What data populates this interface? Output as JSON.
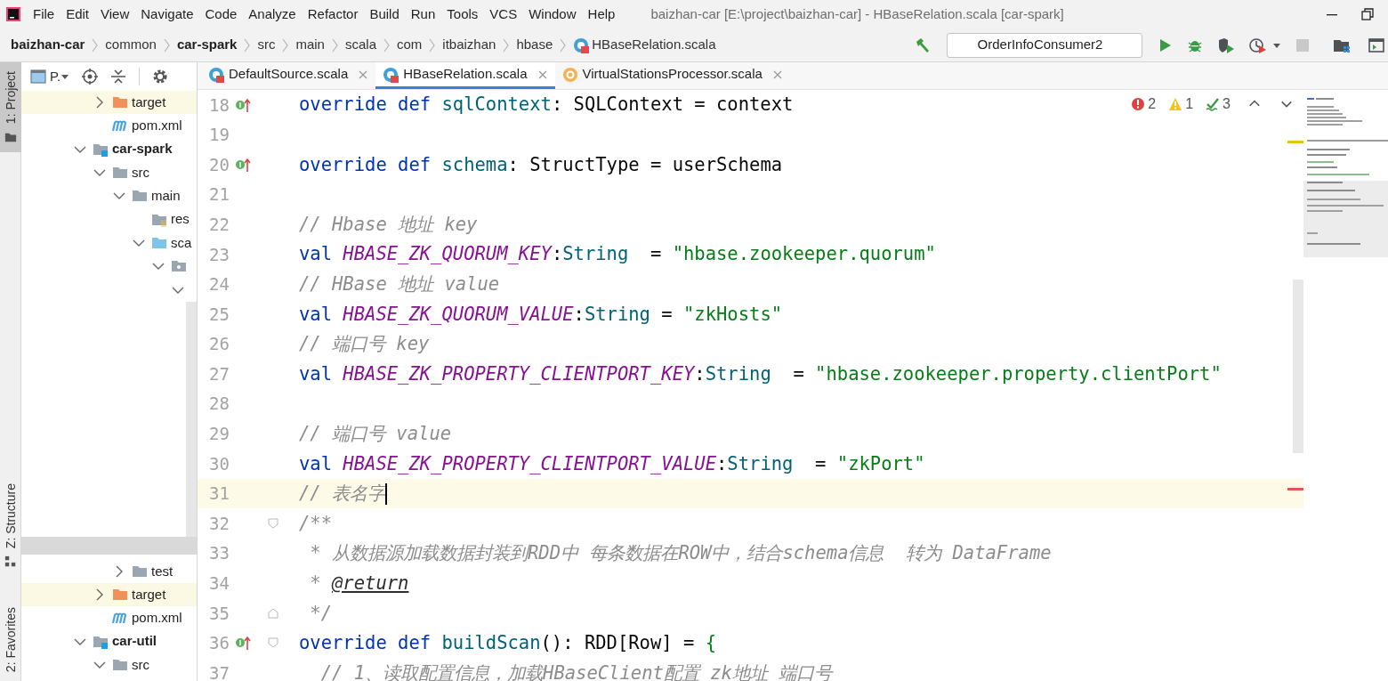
{
  "app_menu": [
    "File",
    "Edit",
    "View",
    "Navigate",
    "Code",
    "Analyze",
    "Refactor",
    "Build",
    "Run",
    "Tools",
    "VCS",
    "Window",
    "Help"
  ],
  "window": {
    "title": "baizhan-car [E:\\project\\baizhan-car] - HBaseRelation.scala [car-spark]"
  },
  "breadcrumbs": [
    {
      "label": "baizhan-car",
      "bold": true,
      "kind": "text"
    },
    {
      "label": "common",
      "bold": false,
      "kind": "text"
    },
    {
      "label": "car-spark",
      "bold": true,
      "kind": "text"
    },
    {
      "label": "src",
      "bold": false,
      "kind": "text"
    },
    {
      "label": "main",
      "bold": false,
      "kind": "text"
    },
    {
      "label": "scala",
      "bold": false,
      "kind": "text"
    },
    {
      "label": "com",
      "bold": false,
      "kind": "text"
    },
    {
      "label": "itbaizhan",
      "bold": false,
      "kind": "text"
    },
    {
      "label": "hbase",
      "bold": false,
      "kind": "text"
    },
    {
      "label": "HBaseRelation.scala",
      "bold": false,
      "kind": "file"
    }
  ],
  "run_config": {
    "label": "OrderInfoConsumer2"
  },
  "tool_stripe": [
    {
      "label": "1: Project",
      "selected": true,
      "kind": "project"
    },
    {
      "label": "Z: Structure",
      "selected": false,
      "kind": "structure"
    },
    {
      "label": "2: Favorites",
      "selected": false,
      "kind": "favorites"
    }
  ],
  "project_panel": {
    "view_label": "P.",
    "tree_continued": [
      {
        "label": "target",
        "kind": "excluded",
        "expanded": false
      },
      {
        "label": "pom.xml",
        "kind": "maven"
      }
    ],
    "tree": [
      {
        "label": "car-spark",
        "kind": "module",
        "expanded": true,
        "children": [
          {
            "label": "src",
            "kind": "folder",
            "expanded": true,
            "children": [
              {
                "label": "main",
                "kind": "folder",
                "expanded": true,
                "children": [
                  {
                    "label": "res",
                    "kind": "resources"
                  },
                  {
                    "label": "sca",
                    "kind": "source",
                    "expanded": true,
                    "children": [
                      {
                        "kind": "package",
                        "expanded": true,
                        "children": [
                          {
                            "expanded": true
                          }
                        ]
                      }
                    ]
                  }
                ]
              },
              {
                "label": "test",
                "kind": "folder",
                "expanded": false,
                "gap_before": true
              }
            ]
          },
          {
            "label": "target",
            "kind": "excluded",
            "expanded": false
          },
          {
            "label": "pom.xml",
            "kind": "maven"
          }
        ]
      },
      {
        "label": "car-util",
        "kind": "module",
        "expanded": true,
        "children": [
          {
            "label": "src",
            "kind": "folder",
            "expanded": true
          }
        ]
      }
    ]
  },
  "tabs": [
    {
      "label": "DefaultSource.scala",
      "kind": "class",
      "selected": false
    },
    {
      "label": "HBaseRelation.scala",
      "kind": "class",
      "selected": true
    },
    {
      "label": "VirtualStationsProcessor.scala",
      "kind": "object",
      "selected": false
    }
  ],
  "inspections": {
    "errors": "2",
    "warnings": "1",
    "typos": "3"
  },
  "code_lines": [
    {
      "number": "18",
      "override_marker": true,
      "fold_start": false,
      "fold_end": false,
      "current": false,
      "tokens": [
        {
          "kind": "keyword",
          "text": "override def"
        },
        {
          "kind": "function",
          "text": " sqlContext"
        },
        {
          "kind": "plain",
          "text": ": SQLContext = context"
        }
      ]
    },
    {
      "number": "19",
      "override_marker": false,
      "fold_start": false,
      "fold_end": false,
      "current": false
    },
    {
      "number": "20",
      "override_marker": true,
      "fold_start": false,
      "fold_end": false,
      "current": false,
      "tokens": [
        {
          "kind": "keyword",
          "text": "override def"
        },
        {
          "kind": "function",
          "text": " schema"
        },
        {
          "kind": "plain",
          "text": ": StructType = userSchema"
        }
      ]
    },
    {
      "number": "21",
      "override_marker": false,
      "fold_start": false,
      "fold_end": false,
      "current": false
    },
    {
      "number": "22",
      "override_marker": false,
      "fold_start": false,
      "fold_end": false,
      "current": false,
      "tokens": [
        {
          "kind": "comment",
          "text": "// Hbase 地址 key"
        }
      ]
    },
    {
      "number": "23",
      "override_marker": false,
      "fold_start": false,
      "fold_end": false,
      "current": false,
      "tokens": [
        {
          "kind": "keyword",
          "text": "val"
        },
        {
          "kind": "constant",
          "text": " HBASE_ZK_QUORUM_KEY"
        },
        {
          "kind": "plain",
          "text": ":"
        },
        {
          "kind": "type",
          "text": "String"
        },
        {
          "kind": "plain",
          "text": "  = "
        },
        {
          "kind": "string",
          "text": "\"hbase.zookeeper.quorum\""
        }
      ]
    },
    {
      "number": "24",
      "override_marker": false,
      "fold_start": false,
      "fold_end": false,
      "current": false,
      "tokens": [
        {
          "kind": "comment",
          "text": "// HBase 地址 value"
        }
      ]
    },
    {
      "number": "25",
      "override_marker": false,
      "fold_start": false,
      "fold_end": false,
      "current": false,
      "tokens": [
        {
          "kind": "keyword",
          "text": "val"
        },
        {
          "kind": "constant",
          "text": " HBASE_ZK_QUORUM_VALUE"
        },
        {
          "kind": "plain",
          "text": ":"
        },
        {
          "kind": "type",
          "text": "String"
        },
        {
          "kind": "plain",
          "text": " = "
        },
        {
          "kind": "string",
          "text": "\"zkHosts\""
        }
      ]
    },
    {
      "number": "26",
      "override_marker": false,
      "fold_start": false,
      "fold_end": false,
      "current": false,
      "tokens": [
        {
          "kind": "comment",
          "text": "// 端口号 key"
        }
      ]
    },
    {
      "number": "27",
      "override_marker": false,
      "fold_start": false,
      "fold_end": false,
      "current": false,
      "tokens": [
        {
          "kind": "keyword",
          "text": "val"
        },
        {
          "kind": "constant",
          "text": " HBASE_ZK_PROPERTY_CLIENTPORT_KEY"
        },
        {
          "kind": "plain",
          "text": ":"
        },
        {
          "kind": "type",
          "text": "String"
        },
        {
          "kind": "plain",
          "text": "  = "
        },
        {
          "kind": "string",
          "text": "\"hbase.zookeeper.property.clientPort\""
        }
      ]
    },
    {
      "number": "28",
      "override_marker": false,
      "fold_start": false,
      "fold_end": false,
      "current": false
    },
    {
      "number": "29",
      "override_marker": false,
      "fold_start": false,
      "fold_end": false,
      "current": false,
      "tokens": [
        {
          "kind": "comment",
          "text": "// 端口号 value"
        }
      ]
    },
    {
      "number": "30",
      "override_marker": false,
      "fold_start": false,
      "fold_end": false,
      "current": false,
      "tokens": [
        {
          "kind": "keyword",
          "text": "val"
        },
        {
          "kind": "constant",
          "text": " HBASE_ZK_PROPERTY_CLIENTPORT_VALUE"
        },
        {
          "kind": "plain",
          "text": ":"
        },
        {
          "kind": "type",
          "text": "String"
        },
        {
          "kind": "plain",
          "text": "  = "
        },
        {
          "kind": "string",
          "text": "\"zkPort\""
        }
      ]
    },
    {
      "number": "31",
      "override_marker": false,
      "fold_start": false,
      "fold_end": false,
      "current": true,
      "tokens": [
        {
          "kind": "comment",
          "text": "// 表名字"
        }
      ]
    },
    {
      "number": "32",
      "override_marker": false,
      "fold_start": true,
      "fold_end": false,
      "current": false,
      "tokens": [
        {
          "kind": "comment",
          "text": "/**"
        }
      ]
    },
    {
      "number": "33",
      "override_marker": false,
      "fold_start": false,
      "fold_end": false,
      "current": false,
      "tokens": [
        {
          "kind": "comment",
          "text": " * 从数据源加载数据封装到RDD中 每条数据在ROW中，结合schema信息  转为 DataFrame"
        }
      ]
    },
    {
      "number": "34",
      "override_marker": false,
      "fold_start": false,
      "fold_end": false,
      "current": false,
      "tokens": [
        {
          "kind": "comment",
          "text": " * "
        },
        {
          "kind": "doc-tag",
          "text": "@return"
        }
      ]
    },
    {
      "number": "35",
      "override_marker": false,
      "fold_start": false,
      "fold_end": true,
      "current": false,
      "tokens": [
        {
          "kind": "comment",
          "text": " */"
        }
      ]
    },
    {
      "number": "36",
      "override_marker": true,
      "fold_start": true,
      "fold_end": false,
      "current": false,
      "tokens": [
        {
          "kind": "keyword",
          "text": "override def"
        },
        {
          "kind": "function",
          "text": " buildScan"
        },
        {
          "kind": "plain",
          "text": "(): RDD[Row] = "
        },
        {
          "kind": "brace",
          "text": "{"
        }
      ]
    },
    {
      "number": "37",
      "override_marker": false,
      "fold_start": false,
      "fold_end": false,
      "current": false,
      "tokens": [
        {
          "kind": "comment",
          "text": "  // 1、读取配置信息，加载HBaseClient配置 zk地址 端口号"
        }
      ]
    }
  ]
}
